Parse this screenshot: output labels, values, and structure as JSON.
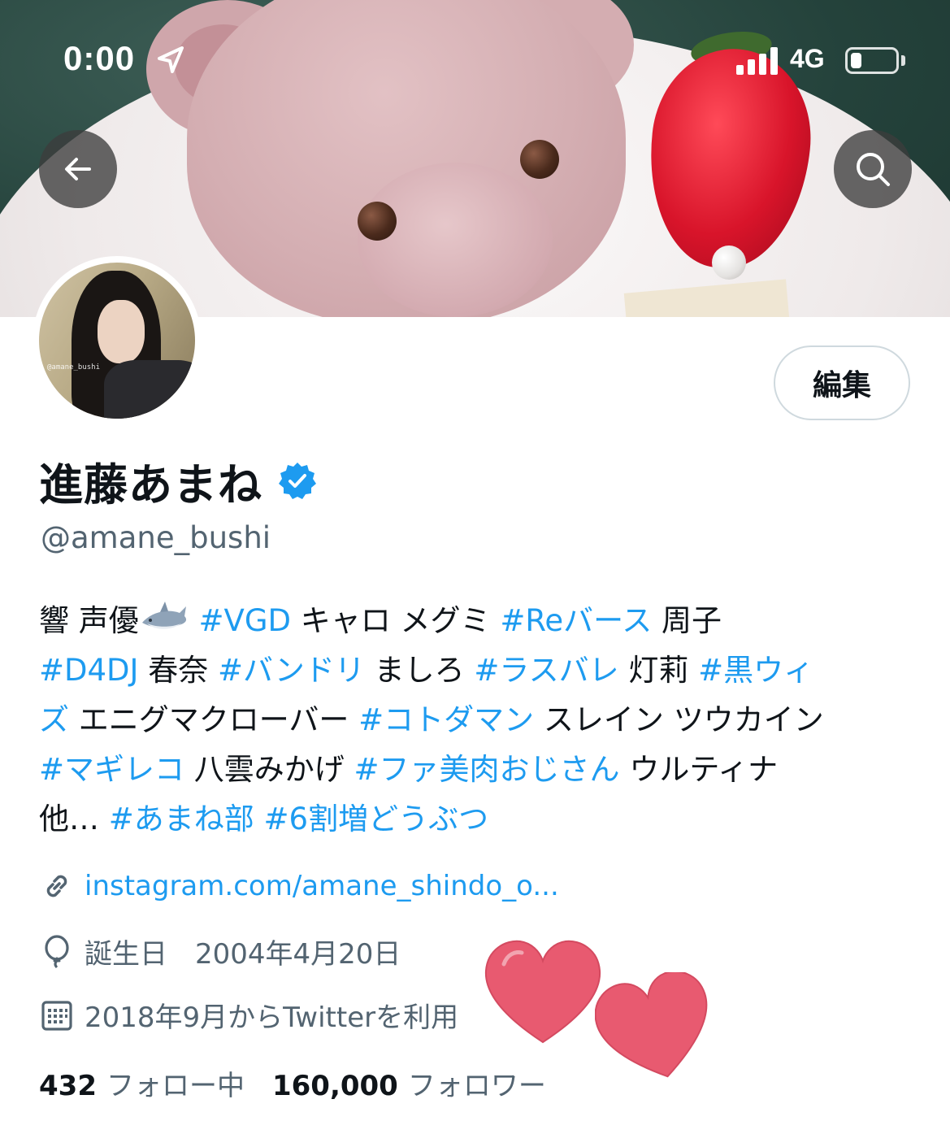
{
  "status_bar": {
    "time": "0:00",
    "network": "4G",
    "signal_bars": 4,
    "battery_level": 0.25
  },
  "header": {
    "back_icon": "arrow-left-icon",
    "search_icon": "search-icon"
  },
  "profile": {
    "avatar_watermark": "@amane_bushi",
    "edit_label": "編集",
    "display_name": "進藤あまね",
    "verified_icon": "verified-badge-icon",
    "handle": "@amane_bushi",
    "bio_lines": [
      [
        {
          "t": "響 声優"
        },
        {
          "emoji": "shark-emoji"
        },
        {
          "t": " "
        },
        {
          "t": "#VGD",
          "tag": true
        },
        {
          "t": " キャロ メグミ "
        },
        {
          "t": "#Reバース",
          "tag": true
        },
        {
          "t": " 周子"
        }
      ],
      [
        {
          "t": "#D4DJ",
          "tag": true
        },
        {
          "t": " 春奈 "
        },
        {
          "t": "#バンドリ",
          "tag": true
        },
        {
          "t": " ましろ "
        },
        {
          "t": "#ラスバレ",
          "tag": true
        },
        {
          "t": " 灯莉 "
        },
        {
          "t": "#黒ウィ",
          "tag": true
        }
      ],
      [
        {
          "t": "ズ",
          "tag": true
        },
        {
          "t": " エニグマクローバー "
        },
        {
          "t": "#コトダマン",
          "tag": true
        },
        {
          "t": " スレイン ツウカイン"
        }
      ],
      [
        {
          "t": "#マギレコ",
          "tag": true
        },
        {
          "t": " 八雲みかげ "
        },
        {
          "t": "#ファ美肉おじさん",
          "tag": true
        },
        {
          "t": " ウルティナ"
        }
      ],
      [
        {
          "t": "他… "
        },
        {
          "t": "#あまね部",
          "tag": true
        },
        {
          "t": " "
        },
        {
          "t": "#6割増どうぶつ",
          "tag": true
        }
      ]
    ],
    "link": "instagram.com/amane_shindo_o...",
    "birthday": "誕生日　2004年4月20日",
    "joined": "2018年9月からTwitterを利用",
    "following_count": "432",
    "following_label": "フォロー中",
    "followers_count": "160,000",
    "followers_label": "フォロワー"
  },
  "colors": {
    "accent": "#1d9bf0",
    "text": "#0f1419",
    "secondary": "#536471",
    "heart": "#e85a70"
  }
}
